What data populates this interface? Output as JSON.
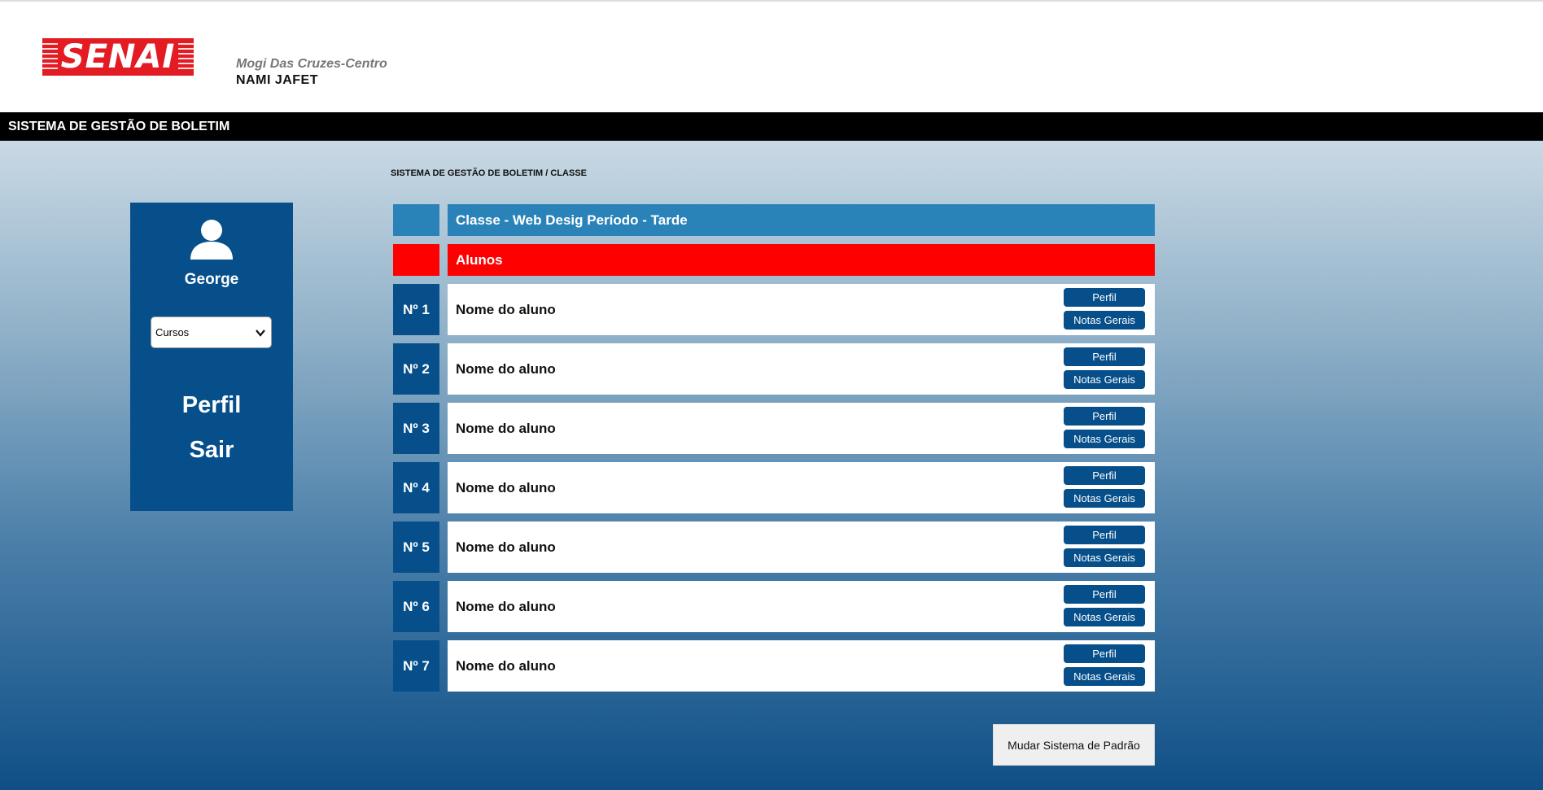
{
  "brand": {
    "logo_text": "SENAI",
    "logo_color": "#e31b23",
    "unit_city": "Mogi Das Cruzes-Centro",
    "unit_name": "NAMI JAFET"
  },
  "titlebar": {
    "title": "SISTEMA DE GESTÃO DE BOLETIM"
  },
  "breadcrumb": {
    "text": "SISTEMA DE GESTÃO DE BOLETIM / CLASSE"
  },
  "sidebar": {
    "avatar_icon": "user-icon",
    "user_name": "George",
    "course_select_value": "Cursos",
    "links": {
      "perfil": "Perfil",
      "sair": "Sair"
    }
  },
  "table": {
    "class_header": "Classe - Web Desig Período - Tarde",
    "students_header": "Alunos",
    "rows": [
      {
        "number": "Nº 1",
        "name": "Nome do aluno",
        "profile_button": "Perfil",
        "grades_button": "Notas Gerais"
      },
      {
        "number": "Nº 2",
        "name": "Nome do aluno",
        "profile_button": "Perfil",
        "grades_button": "Notas Gerais"
      },
      {
        "number": "Nº 3",
        "name": "Nome do aluno",
        "profile_button": "Perfil",
        "grades_button": "Notas Gerais"
      },
      {
        "number": "Nº 4",
        "name": "Nome do aluno",
        "profile_button": "Perfil",
        "grades_button": "Notas Gerais"
      },
      {
        "number": "Nº 5",
        "name": "Nome do aluno",
        "profile_button": "Perfil",
        "grades_button": "Notas Gerais"
      },
      {
        "number": "Nº 6",
        "name": "Nome do aluno",
        "profile_button": "Perfil",
        "grades_button": "Notas Gerais"
      },
      {
        "number": "Nº 7",
        "name": "Nome do aluno",
        "profile_button": "Perfil",
        "grades_button": "Notas Gerais"
      }
    ]
  },
  "footer": {
    "change_system_button": "Mudar Sistema de Padrão"
  },
  "colors": {
    "primary_blue": "#064f8a",
    "class_header_blue": "#2a83b8",
    "students_header_red": "#ff0000",
    "titlebar_black": "#000000"
  }
}
